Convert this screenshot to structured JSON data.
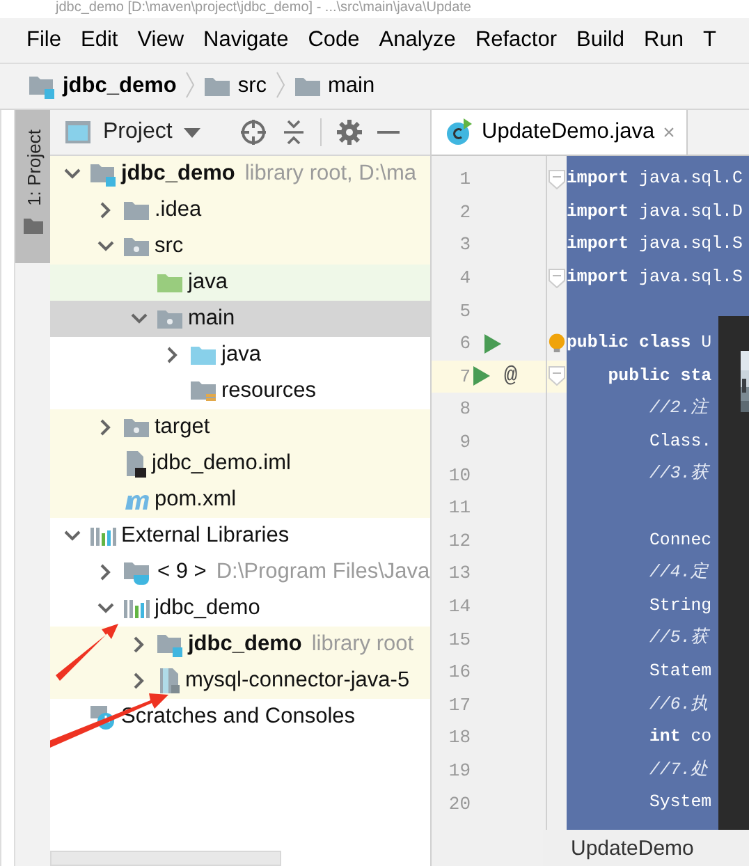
{
  "window": {
    "title": "jdbc_demo [D:\\maven\\project\\jdbc_demo] - ...\\src\\main\\java\\Update"
  },
  "menu": [
    "File",
    "Edit",
    "View",
    "Navigate",
    "Code",
    "Analyze",
    "Refactor",
    "Build",
    "Run",
    "T"
  ],
  "breadcrumbs": [
    {
      "label": "jdbc_demo",
      "kind": "module"
    },
    {
      "label": "src",
      "kind": "folder"
    },
    {
      "label": "main",
      "kind": "folder"
    }
  ],
  "side_tab": {
    "label": "1: Project",
    "selected": true
  },
  "project_panel": {
    "title": "Project",
    "tree": [
      {
        "label": "jdbc_demo",
        "hint": "library root,  D:\\ma",
        "kind": "module",
        "bold": true,
        "expanded": true,
        "highlighted": true,
        "selected": false,
        "children": [
          {
            "label": ".idea",
            "kind": "folder",
            "expanded": false,
            "highlighted": true,
            "selected": false
          },
          {
            "label": "src",
            "kind": "source",
            "expanded": true,
            "highlighted": true,
            "selected": false,
            "children": [
              {
                "label": "java",
                "kind": "test",
                "highlighted": false,
                "selected": false
              },
              {
                "label": "main",
                "kind": "source",
                "expanded": true,
                "highlighted": false,
                "selected": true,
                "children": [
                  {
                    "label": "java",
                    "kind": "java",
                    "expanded": false,
                    "highlighted": false,
                    "selected": false
                  },
                  {
                    "label": "resources",
                    "kind": "resources",
                    "highlighted": false,
                    "selected": false
                  }
                ]
              }
            ]
          },
          {
            "label": "target",
            "kind": "source",
            "expanded": false,
            "highlighted": true,
            "selected": false
          },
          {
            "label": "jdbc_demo.iml",
            "kind": "iml",
            "highlighted": true,
            "selected": false
          },
          {
            "label": "pom.xml",
            "kind": "maven",
            "highlighted": true,
            "selected": false
          }
        ]
      },
      {
        "label": "External Libraries",
        "kind": "libraries",
        "expanded": true,
        "highlighted": false,
        "selected": false,
        "children": [
          {
            "label": "< 9 >",
            "hint": "D:\\Program Files\\Java",
            "kind": "jdk",
            "expanded": false,
            "highlighted": false,
            "selected": false
          },
          {
            "label": "jdbc_demo",
            "kind": "libraries",
            "expanded": true,
            "highlighted": false,
            "selected": false,
            "children": [
              {
                "label": "jdbc_demo",
                "hint": "library root",
                "kind": "module",
                "bold": true,
                "expanded": false,
                "highlighted": true,
                "selected": false
              },
              {
                "label": "mysql-connector-java-5",
                "kind": "jar",
                "expanded": false,
                "highlighted": true,
                "selected": false
              }
            ]
          }
        ]
      },
      {
        "label": "Scratches and Consoles",
        "kind": "scratches",
        "highlighted": false,
        "selected": false
      }
    ]
  },
  "editor": {
    "tab": {
      "label": "UpdateDemo.java",
      "close": "×",
      "selected": true
    },
    "lines": [
      {
        "number": "1",
        "code": "**import** java.sql.C",
        "fold": true
      },
      {
        "number": "2",
        "code": "**import** java.sql.D"
      },
      {
        "number": "3",
        "code": "**import** java.sql.S"
      },
      {
        "number": "4",
        "code": "**import** java.sql.S",
        "fold": true
      },
      {
        "number": "5"
      },
      {
        "number": "6",
        "code": "**public class** U",
        "run": true,
        "bulb": true
      },
      {
        "number": "7",
        "code": "    **public sta**",
        "run": true,
        "gutter_mark": "@",
        "fold": true,
        "current": true
      },
      {
        "number": "8",
        "code": "        //2.注",
        "comment": true
      },
      {
        "number": "9",
        "code": "        Class."
      },
      {
        "number": "10",
        "code": "        //3.获",
        "comment": true
      },
      {
        "number": "11"
      },
      {
        "number": "12",
        "code": "        Connec"
      },
      {
        "number": "13",
        "code": "        //4.定",
        "comment": true
      },
      {
        "number": "14",
        "code": "        String"
      },
      {
        "number": "15",
        "code": "        //5.获",
        "comment": true
      },
      {
        "number": "16",
        "code": "        Statem"
      },
      {
        "number": "17",
        "code": "        //6.执",
        "comment": true
      },
      {
        "number": "18",
        "code": "        **int** co"
      },
      {
        "number": "19",
        "code": "        //7.处",
        "comment": true
      },
      {
        "number": "20",
        "code": "        System"
      }
    ],
    "footer": "UpdateDemo"
  }
}
